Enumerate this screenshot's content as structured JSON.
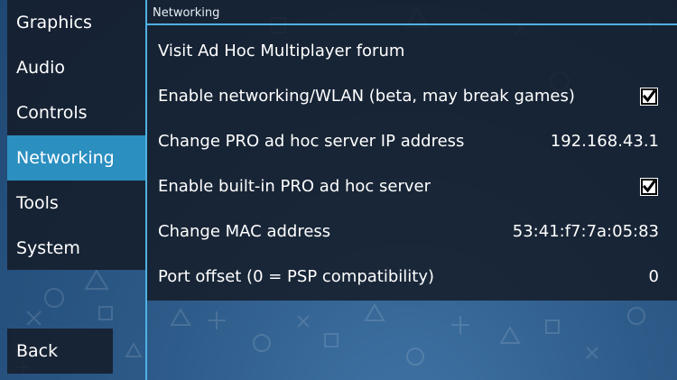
{
  "sidebar": {
    "items": [
      {
        "label": "Graphics"
      },
      {
        "label": "Audio"
      },
      {
        "label": "Controls"
      },
      {
        "label": "Networking"
      },
      {
        "label": "Tools"
      },
      {
        "label": "System"
      }
    ],
    "active_index": 3
  },
  "back_button": {
    "label": "Back"
  },
  "panel": {
    "header": "Networking",
    "rows": [
      {
        "label": "Visit Ad Hoc Multiplayer forum"
      },
      {
        "label": "Enable networking/WLAN (beta, may break games)",
        "checked": true,
        "checkbox_icon": "checkbox-checked-icon"
      },
      {
        "label": "Change PRO ad hoc server IP address",
        "value": "192.168.43.1"
      },
      {
        "label": "Enable built-in PRO ad hoc server",
        "checked": true,
        "checkbox_icon": "checkbox-checked-icon"
      },
      {
        "label": "Change MAC address",
        "value": "53:41:f7:7a:05:83"
      },
      {
        "label": "Port offset (0 = PSP compatibility)",
        "value": "0"
      }
    ]
  },
  "colors": {
    "accent": "#2b8fc0",
    "divider": "#4fb1e3",
    "background_top": "#1f4773",
    "background_bottom": "#3f73a4"
  }
}
